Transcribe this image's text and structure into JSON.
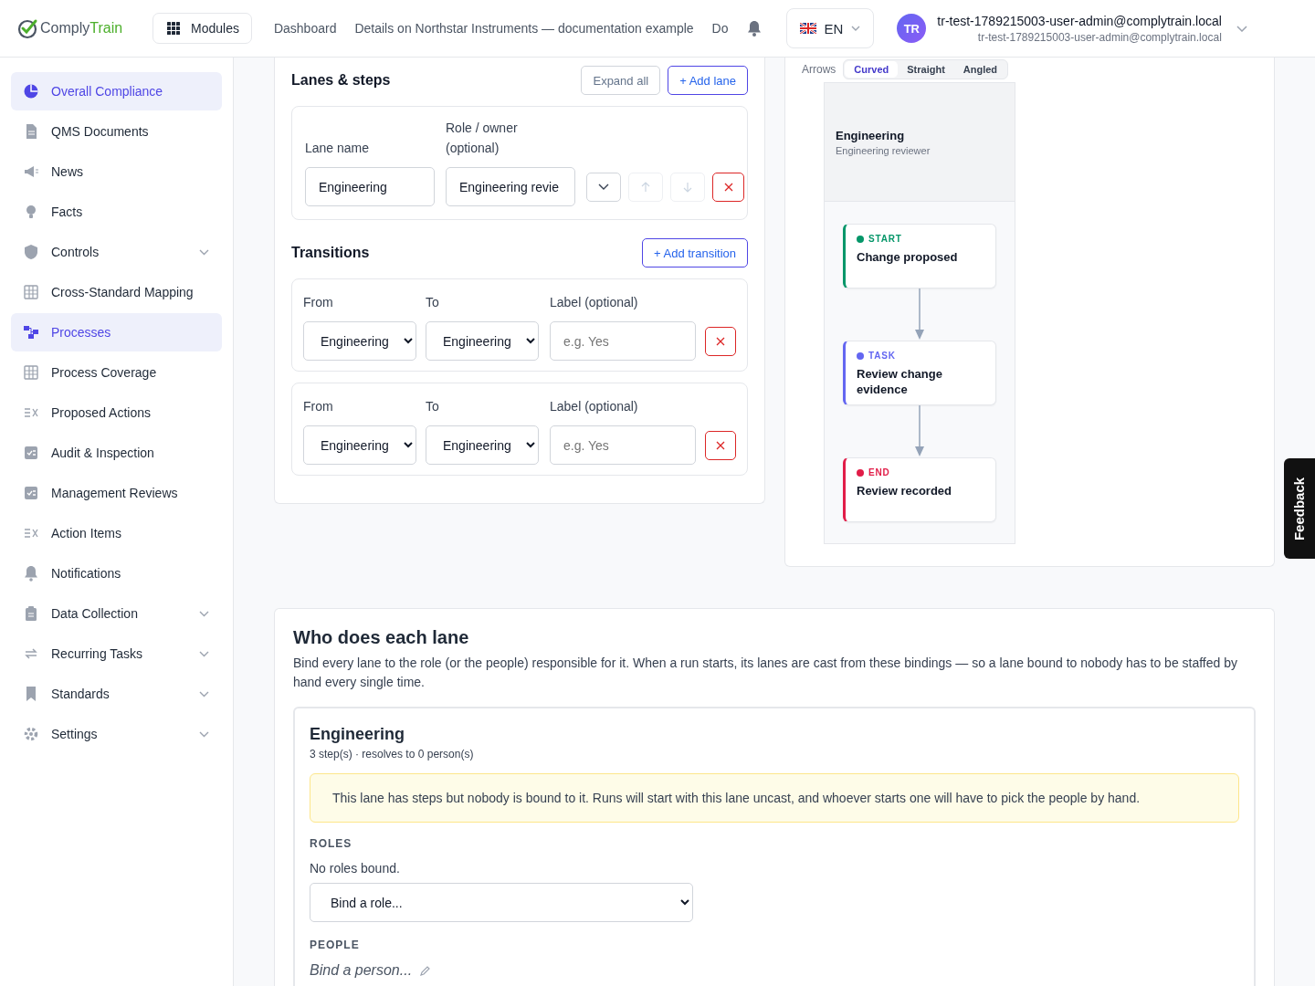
{
  "header": {
    "brand": [
      "Comply",
      "Train"
    ],
    "modules_button": "Modules",
    "nav": [
      "Dashboard",
      "Details on Northstar Instruments — documentation example",
      "Do"
    ],
    "language": "EN",
    "avatar": "TR",
    "user_name": "tr-test-1789215003-user-admin@complytrain.local",
    "user_email": "tr-test-1789215003-user-admin@complytrain.local"
  },
  "sidebar": {
    "items": [
      {
        "label": "Overall Compliance",
        "selected": true,
        "kind": "link"
      },
      {
        "label": "QMS Documents",
        "selected": false,
        "kind": "link"
      },
      {
        "label": "News",
        "selected": false,
        "kind": "link"
      },
      {
        "label": "Facts",
        "selected": false,
        "kind": "link"
      },
      {
        "label": "Controls",
        "selected": false,
        "kind": "group"
      },
      {
        "label": "Cross-Standard Mapping",
        "selected": false,
        "kind": "link"
      },
      {
        "label": "Processes",
        "selected": true,
        "kind": "link"
      },
      {
        "label": "Process Coverage",
        "selected": false,
        "kind": "link"
      },
      {
        "label": "Proposed Actions",
        "selected": false,
        "kind": "link"
      },
      {
        "label": "Audit & Inspection",
        "selected": false,
        "kind": "link"
      },
      {
        "label": "Management Reviews",
        "selected": false,
        "kind": "link"
      },
      {
        "label": "Action Items",
        "selected": false,
        "kind": "link"
      },
      {
        "label": "Notifications",
        "selected": false,
        "kind": "link"
      },
      {
        "label": "Data Collection",
        "selected": false,
        "kind": "group"
      },
      {
        "label": "Recurring Tasks",
        "selected": false,
        "kind": "group"
      },
      {
        "label": "Standards",
        "selected": false,
        "kind": "group"
      },
      {
        "label": "Settings",
        "selected": false,
        "kind": "group"
      }
    ]
  },
  "lanes": {
    "title": "Lanes & steps",
    "expand_button": "Expand all",
    "add_button": "+ Add lane",
    "name_label": "Lane name",
    "role_label": "Role / owner (optional)",
    "rows": [
      {
        "name": "Engineering",
        "role": "Engineering revie",
        "can_move_up": false,
        "can_move_down": false
      }
    ]
  },
  "transitions": {
    "title": "Transitions",
    "add_button": "+ Add transition",
    "rows": [
      {
        "from_label": "From",
        "to_label": "To",
        "label_label": "Label (optional)",
        "from": "Engineering",
        "to": "Engineering",
        "placeholder": "e.g. Yes"
      },
      {
        "from_label": "From",
        "to_label": "To",
        "label_label": "Label (optional)",
        "from": "Engineering",
        "to": "Engineering",
        "placeholder": "e.g. Yes"
      }
    ]
  },
  "diagram": {
    "arrows_label": "Arrows",
    "arrow_styles": [
      {
        "label": "Curved",
        "selected": true
      },
      {
        "label": "Straight",
        "selected": false
      },
      {
        "label": "Angled",
        "selected": false
      }
    ],
    "lane": {
      "name": "Engineering",
      "role": "Engineering reviewer"
    },
    "nodes": [
      {
        "tag": "START",
        "title": "Change proposed",
        "color": "#059669"
      },
      {
        "tag": "TASK",
        "title": "Review change evidence",
        "color": "#6366f1"
      },
      {
        "tag": "END",
        "title": "Review recorded",
        "color": "#e11d48"
      }
    ]
  },
  "bindings": {
    "title": "Who does each lane",
    "description": "Bind every lane to the role (or the people) responsible for it. When a run starts, its lanes are cast from these bindings — so a lane bound to nobody has to be staffed by hand every single time.",
    "lanes": [
      {
        "name": "Engineering",
        "summary": "3 step(s) · resolves to 0 person(s)",
        "warning": "This lane has steps but nobody is bound to it. Runs will start with this lane uncast, and whoever starts one will have to pick the people by hand.",
        "roles_heading": "ROLES",
        "roles_empty": "No roles bound.",
        "role_select": "Bind a role...",
        "people_heading": "PEOPLE",
        "people_placeholder": "Bind a person..."
      }
    ]
  },
  "feedback": "Feedback"
}
